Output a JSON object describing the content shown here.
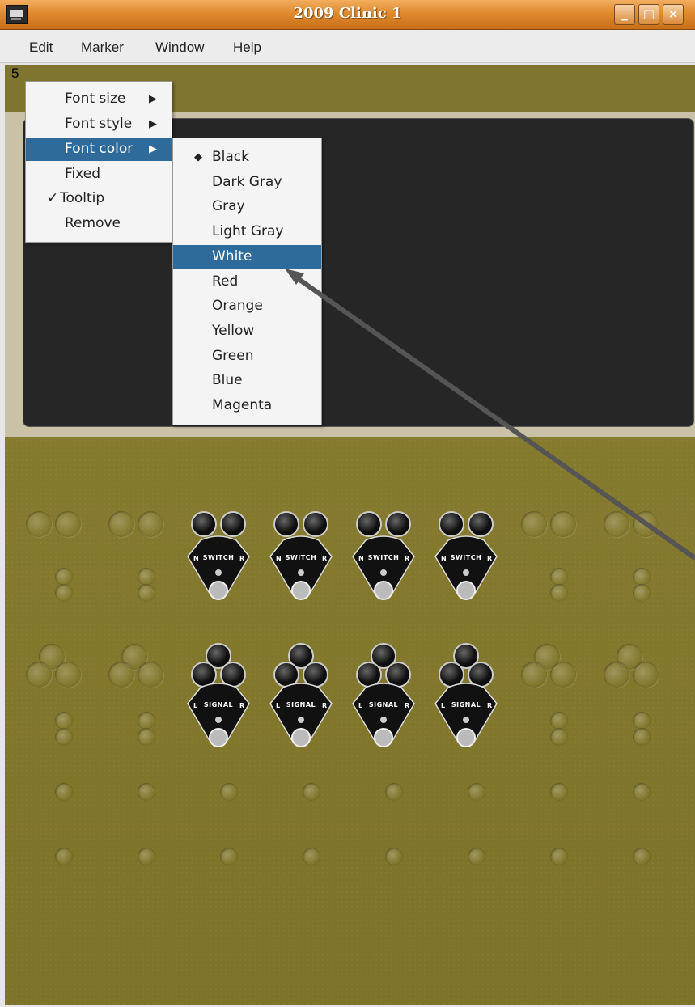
{
  "window": {
    "title": "2009 Clinic 1",
    "buttons": {
      "minimize": "_",
      "maximize": "□",
      "close": "×"
    }
  },
  "menubar": {
    "items": [
      "Edit",
      "Marker",
      "Window",
      "Help"
    ]
  },
  "marker_label": "5",
  "context_menu": {
    "items": [
      {
        "label": "Font size",
        "submenu_arrow": "▶"
      },
      {
        "label": "Font style",
        "submenu_arrow": "▶"
      },
      {
        "label": "Font color",
        "submenu_arrow": "▶",
        "highlighted": true
      },
      {
        "label": "Fixed"
      },
      {
        "label": "Tooltip",
        "check": "✓",
        "checked": true
      },
      {
        "label": "Remove"
      }
    ]
  },
  "color_submenu": {
    "selected_mark": "◆",
    "items": [
      "Black",
      "Dark Gray",
      "Gray",
      "Light Gray",
      "White",
      "Red",
      "Orange",
      "Yellow",
      "Green",
      "Blue",
      "Magenta"
    ],
    "selected": "Black",
    "highlighted": "White"
  },
  "panel": {
    "switch_plates": [
      "SWITCH",
      "SWITCH",
      "SWITCH",
      "SWITCH"
    ],
    "signal_plates": [
      "SIGNAL",
      "SIGNAL",
      "SIGNAL",
      "SIGNAL"
    ],
    "plate_side_left": "N",
    "plate_side_right": "R",
    "signal_side_left": "L"
  },
  "colors": {
    "titlebar": "#e08a2e",
    "menu_highlight": "#2f6b9a",
    "panel_background": "#857a30",
    "dark_panel": "#262626"
  }
}
